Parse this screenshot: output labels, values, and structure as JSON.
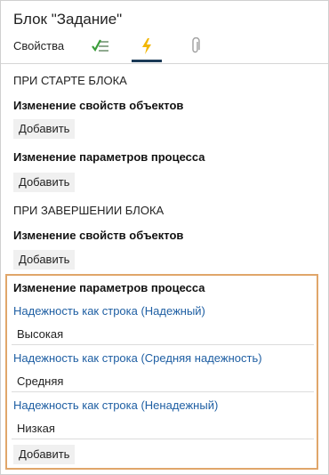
{
  "header": {
    "title": "Блок \"Задание\""
  },
  "tabs": {
    "properties_label": "Свойства",
    "icons": [
      "checklist-icon",
      "lightning-icon",
      "paperclip-icon"
    ]
  },
  "on_start": {
    "heading": "ПРИ СТАРТЕ БЛОКА",
    "change_objects": {
      "title": "Изменение свойств объектов",
      "add_label": "Добавить"
    },
    "change_params": {
      "title": "Изменение параметров процесса",
      "add_label": "Добавить"
    }
  },
  "on_finish": {
    "heading": "ПРИ ЗАВЕРШЕНИИ БЛОКА",
    "change_objects": {
      "title": "Изменение свойств объектов",
      "add_label": "Добавить"
    },
    "change_params": {
      "title": "Изменение параметров процесса",
      "params": [
        {
          "link": "Надежность как строка (Надежный)",
          "value": "Высокая"
        },
        {
          "link": "Надежность как строка (Средняя надежность)",
          "value": "Средняя"
        },
        {
          "link": "Надежность как строка (Ненадежный)",
          "value": "Низкая"
        }
      ],
      "add_label": "Добавить"
    }
  },
  "colors": {
    "accent_underline": "#1b3a57",
    "link": "#1f5fa3",
    "highlight_border": "#e0a66a",
    "lightning": "#f2b705",
    "checklist": "#3a9d3a"
  }
}
